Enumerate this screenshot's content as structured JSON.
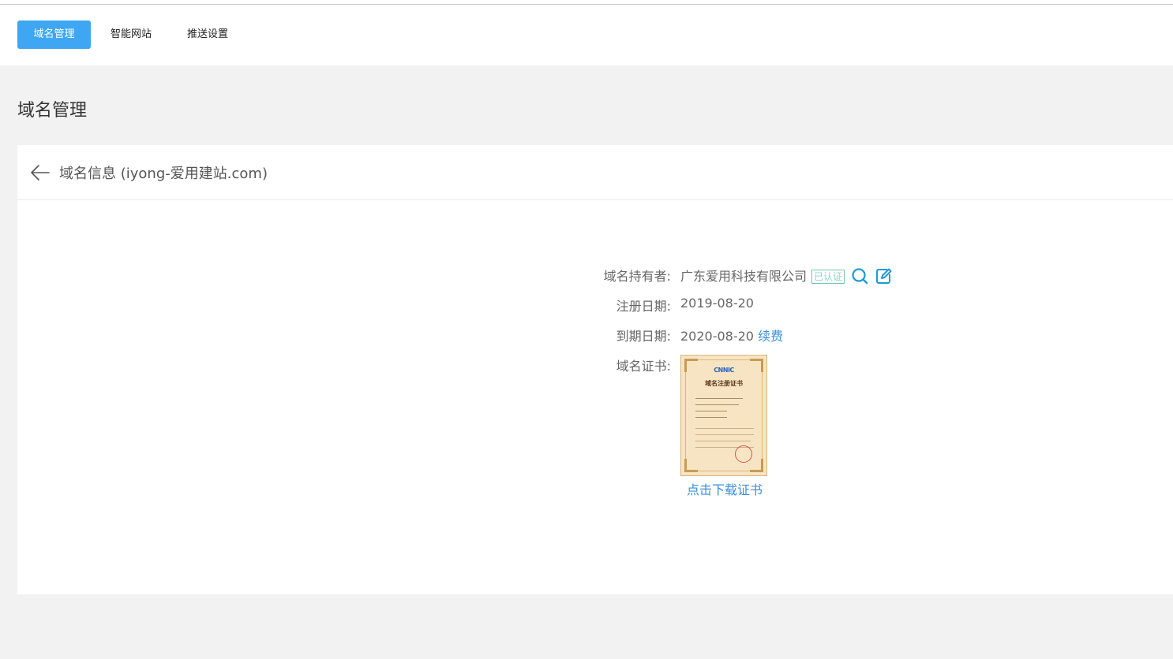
{
  "tabs": [
    {
      "label": "域名管理",
      "active": true
    },
    {
      "label": "智能网站",
      "active": false
    },
    {
      "label": "推送设置",
      "active": false
    }
  ],
  "page_title": "域名管理",
  "card": {
    "title": "域名信息",
    "domain": "iyong-爱用建站.com"
  },
  "info": {
    "owner_label": "域名持有者:",
    "owner_value": "广东爱用科技有限公司",
    "owner_badge": "已认证",
    "reg_label": "注册日期:",
    "reg_value": "2019-08-20",
    "exp_label": "到期日期:",
    "exp_value": "2020-08-20",
    "renew_label": "续费",
    "cert_label": "域名证书:",
    "cert_download": "点击下载证书"
  },
  "certificate": {
    "logo_text": "CNNIC",
    "title_text": "域名注册证书"
  },
  "colors": {
    "accent": "#3ea6f3",
    "link": "#3a8fd9",
    "badge": "#6fc6b0"
  },
  "icons": {
    "back": "arrow-left-icon",
    "search": "search-icon",
    "edit": "edit-icon"
  }
}
